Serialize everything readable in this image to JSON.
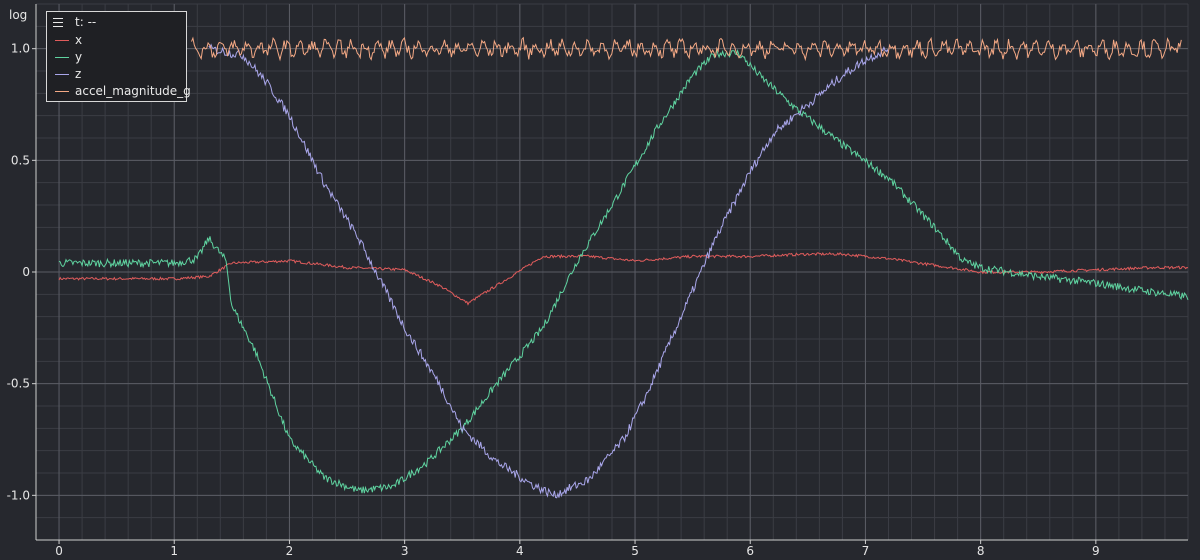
{
  "chart_data": {
    "type": "line",
    "y_axis_unit_label": "log",
    "xlim": [
      -0.2,
      9.8
    ],
    "ylim": [
      -1.2,
      1.2
    ],
    "x_ticks": [
      "0",
      "1",
      "2",
      "3",
      "4",
      "5",
      "6",
      "7",
      "8",
      "9"
    ],
    "y_ticks": [
      "1.0",
      "0.5",
      "0",
      "-0.5",
      "-1.0"
    ],
    "grid": true,
    "legend_placement": "top-left",
    "legend_header": "t: --",
    "series": [
      {
        "name": "x",
        "color": "#e05c5c",
        "x": [
          0,
          1,
          1.3,
          1.5,
          2.0,
          2.5,
          3.0,
          3.3,
          3.55,
          3.8,
          4.2,
          4.6,
          5.0,
          5.5,
          6.0,
          6.5,
          6.8,
          7.2,
          7.6,
          8.0,
          8.5,
          9.0,
          9.5,
          9.8
        ],
        "y": [
          -0.03,
          -0.03,
          -0.02,
          0.04,
          0.05,
          0.02,
          0.01,
          -0.06,
          -0.14,
          -0.06,
          0.07,
          0.07,
          0.05,
          0.07,
          0.07,
          0.08,
          0.08,
          0.06,
          0.03,
          0.0,
          0.0,
          0.01,
          0.02,
          0.02
        ]
      },
      {
        "name": "y",
        "color": "#5fd3a0",
        "x": [
          0,
          1,
          1.2,
          1.3,
          1.45,
          1.5,
          1.7,
          2.0,
          2.3,
          2.6,
          2.9,
          3.2,
          3.5,
          3.8,
          4.2,
          4.5,
          4.8,
          5.2,
          5.5,
          5.7,
          5.9,
          6.1,
          6.4,
          6.8,
          7.2,
          7.6,
          7.85,
          8.0,
          8.5,
          9.0,
          9.5,
          9.8
        ],
        "y": [
          0.04,
          0.04,
          0.06,
          0.15,
          0.05,
          -0.15,
          -0.35,
          -0.75,
          -0.92,
          -0.98,
          -0.96,
          -0.85,
          -0.7,
          -0.5,
          -0.25,
          0.05,
          0.3,
          0.65,
          0.88,
          0.98,
          0.98,
          0.87,
          0.73,
          0.57,
          0.42,
          0.2,
          0.05,
          0.02,
          -0.02,
          -0.05,
          -0.09,
          -0.11
        ]
      },
      {
        "name": "z",
        "color": "#a9a6ea",
        "x": [
          1.3,
          1.6,
          1.8,
          2.0,
          2.3,
          2.6,
          3.0,
          3.3,
          3.5,
          3.8,
          4.1,
          4.3,
          4.6,
          4.9,
          5.1,
          5.4,
          5.7,
          6.0,
          6.2,
          6.5,
          6.8,
          7.0,
          7.2
        ],
        "y": [
          1.0,
          0.97,
          0.85,
          0.7,
          0.4,
          0.15,
          -0.25,
          -0.5,
          -0.7,
          -0.85,
          -0.95,
          -1.0,
          -0.93,
          -0.75,
          -0.55,
          -0.2,
          0.15,
          0.45,
          0.62,
          0.75,
          0.88,
          0.95,
          1.0
        ]
      },
      {
        "name": "accel_magnitude_g",
        "color": "#f4a985",
        "x_start": 1.15,
        "x_end": 9.75,
        "baseline": 1.0,
        "noise_amplitude": 0.05
      }
    ]
  }
}
